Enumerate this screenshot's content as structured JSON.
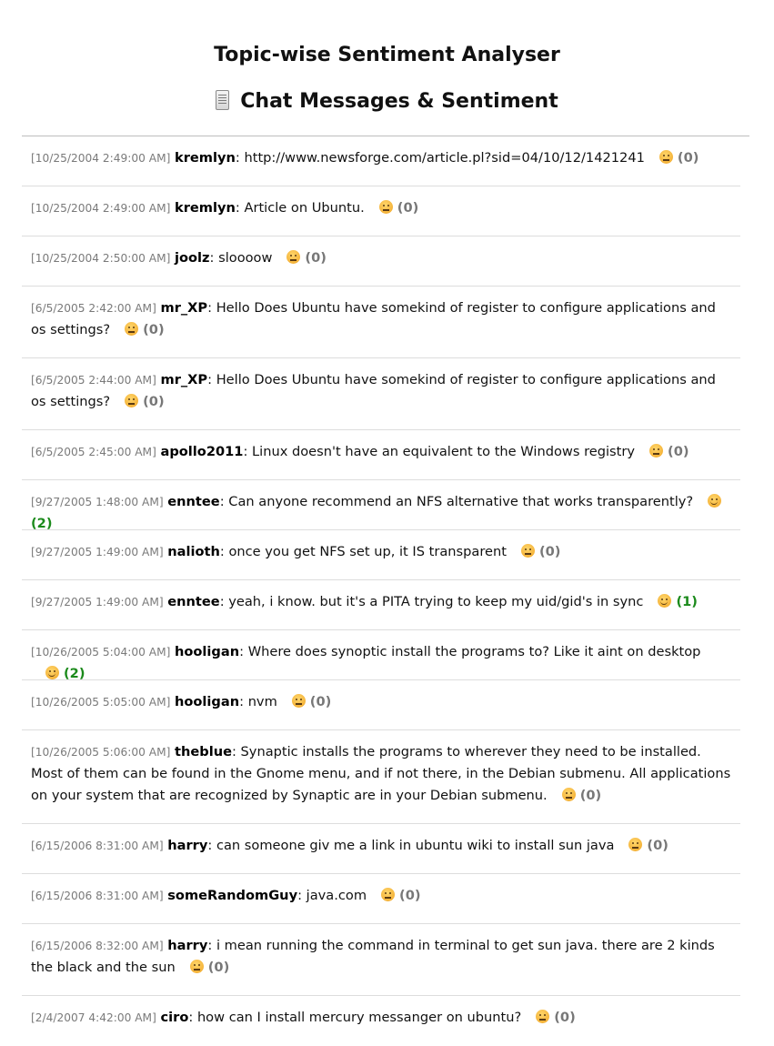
{
  "app_title": "Topic-wise Sentiment Analyser",
  "section_title": "Chat Messages & Sentiment",
  "icons": {
    "section": "document-icon",
    "neutral": "neutral-face-icon",
    "positive": "smiling-face-icon"
  },
  "colors": {
    "timestamp": "#7a7a7a",
    "score_neutral": "#777777",
    "score_positive": "#1b8a1b"
  },
  "messages": [
    {
      "timestamp": "[10/25/2004 2:49:00 AM]",
      "user": "kremlyn",
      "text": "http://www.newsforge.com/article.pl?sid=04/10/12/1421241",
      "sentiment": "neutral",
      "score": "(0)"
    },
    {
      "timestamp": "[10/25/2004 2:49:00 AM]",
      "user": "kremlyn",
      "text": "Article on Ubuntu.",
      "sentiment": "neutral",
      "score": "(0)"
    },
    {
      "timestamp": "[10/25/2004 2:50:00 AM]",
      "user": "joolz",
      "text": "sloooow",
      "sentiment": "neutral",
      "score": "(0)"
    },
    {
      "timestamp": "[6/5/2005 2:42:00 AM]",
      "user": "mr_XP",
      "text": "Hello Does Ubuntu have somekind of register to configure applications and os settings?",
      "sentiment": "neutral",
      "score": "(0)"
    },
    {
      "timestamp": "[6/5/2005 2:44:00 AM]",
      "user": "mr_XP",
      "text": "Hello Does Ubuntu have somekind of register to configure applications and os settings?",
      "sentiment": "neutral",
      "score": "(0)"
    },
    {
      "timestamp": "[6/5/2005 2:45:00 AM]",
      "user": "apollo2011",
      "text": "Linux doesn't have an equivalent to the Windows registry",
      "sentiment": "neutral",
      "score": "(0)"
    },
    {
      "timestamp": "[9/27/2005 1:48:00 AM]",
      "user": "enntee",
      "text": "Can anyone recommend an NFS alternative that works transparently?",
      "sentiment": "positive",
      "score": "(2)"
    },
    {
      "timestamp": "[9/27/2005 1:49:00 AM]",
      "user": "nalioth",
      "text": "once you get NFS set up, it IS transparent",
      "sentiment": "neutral",
      "score": "(0)"
    },
    {
      "timestamp": "[9/27/2005 1:49:00 AM]",
      "user": "enntee",
      "text": "yeah, i know. but it's a PITA trying to keep my uid/gid's in sync",
      "sentiment": "positive",
      "score": "(1)"
    },
    {
      "timestamp": "[10/26/2005 5:04:00 AM]",
      "user": "hooligan",
      "text": "Where does synoptic install the programs to? Like it aint on desktop",
      "sentiment": "positive",
      "score": "(2)"
    },
    {
      "timestamp": "[10/26/2005 5:05:00 AM]",
      "user": "hooligan",
      "text": "nvm",
      "sentiment": "neutral",
      "score": "(0)"
    },
    {
      "timestamp": "[10/26/2005 5:06:00 AM]",
      "user": "theblue",
      "text": "Synaptic installs the programs to wherever they need to be installed. Most of them can be found in the Gnome menu, and if not there, in the Debian submenu. All applications on your system that are recognized by Synaptic are in your Debian submenu.",
      "sentiment": "neutral",
      "score": "(0)"
    },
    {
      "timestamp": "[6/15/2006 8:31:00 AM]",
      "user": "harry",
      "text": "can someone giv me a link in ubuntu wiki to install sun java",
      "sentiment": "neutral",
      "score": "(0)"
    },
    {
      "timestamp": "[6/15/2006 8:31:00 AM]",
      "user": "someRandomGuy",
      "text": "java.com",
      "sentiment": "neutral",
      "score": "(0)"
    },
    {
      "timestamp": "[6/15/2006 8:32:00 AM]",
      "user": "harry",
      "text": "i mean running the command in terminal to get sun java. there are 2 kinds the black and the sun",
      "sentiment": "neutral",
      "score": "(0)"
    },
    {
      "timestamp": "[2/4/2007 4:42:00 AM]",
      "user": "ciro",
      "text": "how can I install mercury messanger on ubuntu?",
      "sentiment": "neutral",
      "score": "(0)"
    }
  ]
}
